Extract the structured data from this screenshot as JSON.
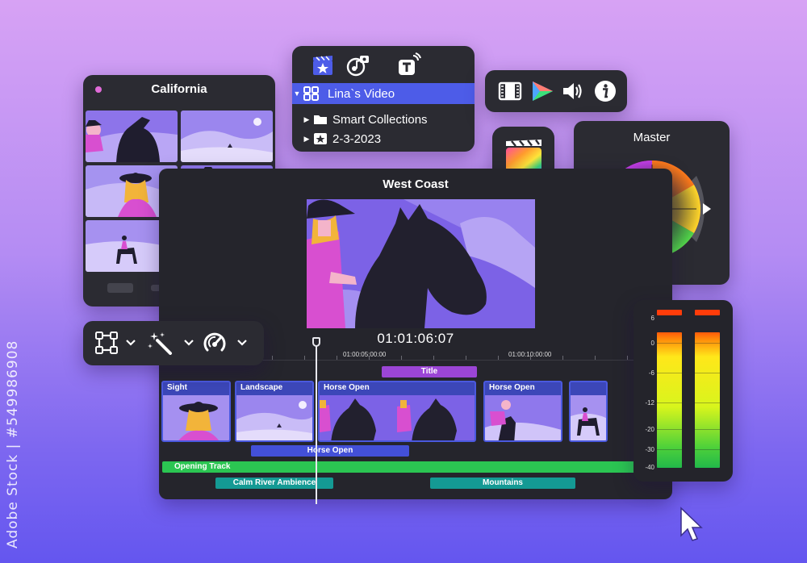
{
  "watermark": {
    "side_text": "Adobe Stock | #549986908"
  },
  "colors": {
    "panel_bg": "#2b2b32",
    "accent_blue": "#4d5ce8",
    "title_purple": "#9b45d6",
    "track_green": "#2bc552",
    "track_teal": "#149a94"
  },
  "california": {
    "title": "California"
  },
  "project": {
    "tabs": [
      {
        "icon": "clapper-star-icon"
      },
      {
        "icon": "music-photo-icon"
      },
      {
        "icon": "titles-icon"
      }
    ],
    "library": "Lina`s Video",
    "items": [
      {
        "label": "Smart Collections",
        "icon": "folder-icon"
      },
      {
        "label": "2-3-2023",
        "icon": "star-event-icon"
      }
    ]
  },
  "inspector": {
    "buttons": [
      {
        "icon": "film-icon"
      },
      {
        "icon": "color-triangle-icon"
      },
      {
        "icon": "speaker-icon"
      },
      {
        "icon": "info-icon"
      }
    ]
  },
  "master": {
    "title": "Master"
  },
  "editor": {
    "title": "West Coast",
    "timecode": "01:01:06:07",
    "ruler_labels": [
      "01:00:05:00:00",
      "01:00:10:00:00"
    ],
    "title_bar": "Title",
    "clips": [
      "Sight",
      "Landscape",
      "Horse Open",
      "Horse Open",
      ""
    ],
    "connected_clip": "Horse Open",
    "audio_main": "Opening Track",
    "audio_tracks": [
      "Calm River Ambience",
      "Mountains"
    ]
  },
  "tools": {
    "buttons": [
      {
        "icon": "transform-icon"
      },
      {
        "icon": "magic-wand-icon"
      },
      {
        "icon": "speedometer-icon"
      }
    ]
  },
  "meters": {
    "scale": [
      "6",
      "0",
      "-6",
      "-12",
      "-20",
      "-30",
      "-40"
    ]
  }
}
